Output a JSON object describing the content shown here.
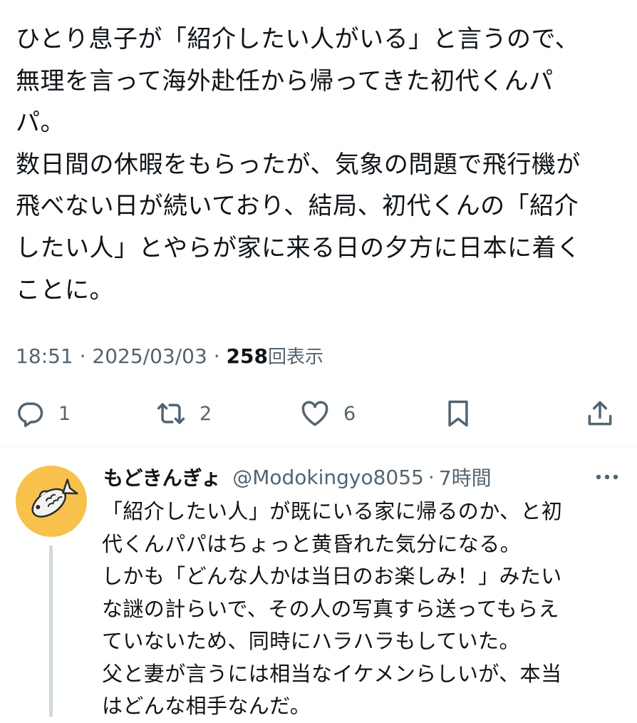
{
  "tweet": {
    "text": "ひとり息子が「紹介したい人がいる」と言うので、\n無理を言って海外赴任から帰ってきた初代くんパ\nパ。\n数日間の休暇をもらったが、気象の問題で飛行機が\n飛べない日が続いており、結局、初代くんの「紹介\nしたい人」とやらが家に来る日の夕方に日本に着く\nことに。",
    "time": "18:51",
    "separator": "·",
    "date": "2025/03/03",
    "views_count": "258",
    "views_label": "回表示"
  },
  "actions": {
    "reply": {
      "icon": "reply-icon",
      "count": "1"
    },
    "retweet": {
      "icon": "retweet-icon",
      "count": "2"
    },
    "like": {
      "icon": "heart-icon",
      "count": "6"
    },
    "bookmark": {
      "icon": "bookmark-icon"
    },
    "share": {
      "icon": "share-icon"
    }
  },
  "reply": {
    "name": "もどきんぎょ",
    "handle": "@Modokingyo8055",
    "separator": "·",
    "time": "7時間",
    "text": "「紹介したい人」が既にいる家に帰るのか、と初\n代くんパパはちょっと黄昏れた気分になる。\nしかも「どんな人かは当日のお楽しみ！」みたい\nな謎の計らいで、その人の写真すら送ってもらえ\nていないため、同時にハラハラもしていた。\n父と妻が言うには相当なイケメンらしいが、本当\nはどんな相手なんだ。",
    "avatar_icon": "fish-icon"
  },
  "colors": {
    "text": "#0f1419",
    "secondary": "#536471",
    "avatar_bg": "#f7c14b",
    "thread_line": "#cfd9de"
  }
}
